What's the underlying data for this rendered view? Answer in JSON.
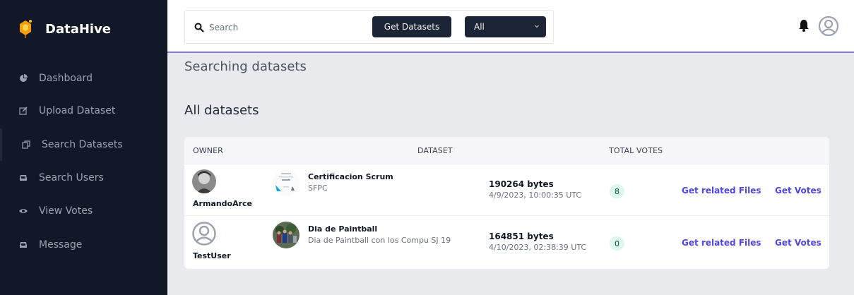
{
  "app": {
    "name": "DataHive"
  },
  "sidebar": {
    "items": [
      {
        "label": "Dashboard",
        "icon": "pie-chart-icon"
      },
      {
        "label": "Upload Dataset",
        "icon": "edit-icon"
      },
      {
        "label": "Search Datasets",
        "icon": "copy-icon",
        "active": true
      },
      {
        "label": "Search Users",
        "icon": "inbox-icon"
      },
      {
        "label": "View Votes",
        "icon": "eye-icon"
      },
      {
        "label": "Message",
        "icon": "inbox-icon"
      }
    ]
  },
  "topbar": {
    "search": {
      "placeholder": "Search",
      "value": ""
    },
    "get_button": "Get Datasets",
    "filter": {
      "selected": "All"
    }
  },
  "main": {
    "heading": "Searching datasets",
    "subheading": "All datasets",
    "table": {
      "columns": [
        "OWNER",
        "DATASET",
        "TOTAL VOTES"
      ],
      "rows": [
        {
          "owner": "ArmandoArce",
          "title": "Certificacion Scrum",
          "subtitle": "SFPC",
          "size": "190264 bytes",
          "date": "4/9/2023, 10:00:35 UTC",
          "votes": "8",
          "files_link": "Get related Files",
          "votes_link": "Get Votes"
        },
        {
          "owner": "TestUser",
          "title": "Dia de Paintball",
          "subtitle": "Dia de Paintball con los Compu SJ 19",
          "size": "164851 bytes",
          "date": "4/10/2023, 02:38:39 UTC",
          "votes": "0",
          "files_link": "Get related Files",
          "votes_link": "Get Votes"
        }
      ]
    }
  },
  "colors": {
    "sidebar_bg": "#111827",
    "accent": "#4f46e5",
    "topbar_border": "#8178e8",
    "button_bg": "#1c2536",
    "badge_bg": "#def7ec",
    "badge_text": "#03543f"
  }
}
